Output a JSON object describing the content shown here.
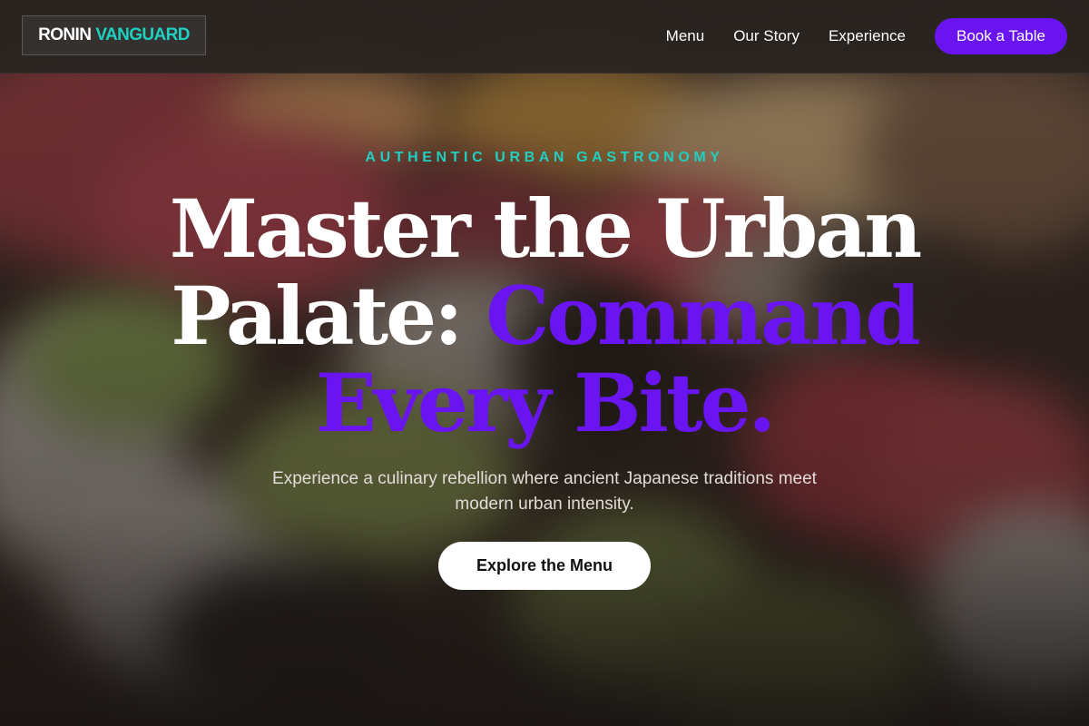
{
  "header": {
    "logo_part1": "RONIN",
    "logo_part2": "VANGUARD",
    "nav": [
      {
        "label": "Menu"
      },
      {
        "label": "Our Story"
      },
      {
        "label": "Experience"
      }
    ],
    "cta_label": "Book a Table"
  },
  "hero": {
    "eyebrow": "AUTHENTIC URBAN GASTRONOMY",
    "headline_line1": "Master the Urban",
    "headline_line2_white": "Palate: ",
    "headline_line2_accent": "Command",
    "headline_line3_accent": "Every Bite.",
    "subtext": "Experience a culinary rebellion where ancient Japanese traditions meet modern urban intensity.",
    "cta_label": "Explore the Menu"
  },
  "colors": {
    "accent_purple": "#6a14f2",
    "accent_teal": "#1fcfc2",
    "header_bg": "#2a2421",
    "cta_white": "#ffffff"
  },
  "icons": {
    "hero_background": "sushi-photo-background"
  }
}
